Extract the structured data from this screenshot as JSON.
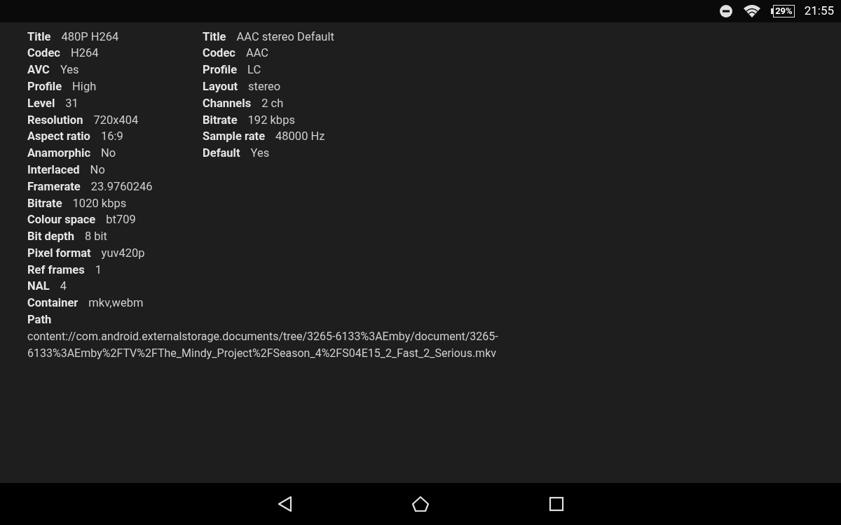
{
  "status_bar": {
    "battery": "29%",
    "time": "21:55"
  },
  "video": [
    {
      "label": "Title",
      "value": "480P H264"
    },
    {
      "label": "Codec",
      "value": "H264"
    },
    {
      "label": "AVC",
      "value": "Yes"
    },
    {
      "label": "Profile",
      "value": "High"
    },
    {
      "label": "Level",
      "value": "31"
    },
    {
      "label": "Resolution",
      "value": "720x404"
    },
    {
      "label": "Aspect ratio",
      "value": "16:9"
    },
    {
      "label": "Anamorphic",
      "value": "No"
    },
    {
      "label": "Interlaced",
      "value": "No"
    },
    {
      "label": "Framerate",
      "value": "23.9760246"
    },
    {
      "label": "Bitrate",
      "value": "1020 kbps"
    },
    {
      "label": "Colour space",
      "value": "bt709"
    },
    {
      "label": "Bit depth",
      "value": "8 bit"
    },
    {
      "label": "Pixel format",
      "value": "yuv420p"
    },
    {
      "label": "Ref frames",
      "value": "1"
    },
    {
      "label": "NAL",
      "value": "4"
    },
    {
      "label": "Container",
      "value": "mkv,webm"
    }
  ],
  "audio": [
    {
      "label": "Title",
      "value": "AAC stereo Default"
    },
    {
      "label": "Codec",
      "value": "AAC"
    },
    {
      "label": "Profile",
      "value": "LC"
    },
    {
      "label": "Layout",
      "value": "stereo"
    },
    {
      "label": "Channels",
      "value": "2 ch"
    },
    {
      "label": "Bitrate",
      "value": "192 kbps"
    },
    {
      "label": "Sample rate",
      "value": "48000 Hz"
    },
    {
      "label": "Default",
      "value": "Yes"
    }
  ],
  "path": {
    "label": "Path",
    "value": "content://com.android.externalstorage.documents/tree/3265-6133%3AEmby/document/3265-6133%3AEmby%2FTV%2FThe_Mindy_Project%2FSeason_4%2FS04E15_2_Fast_2_Serious.mkv"
  }
}
